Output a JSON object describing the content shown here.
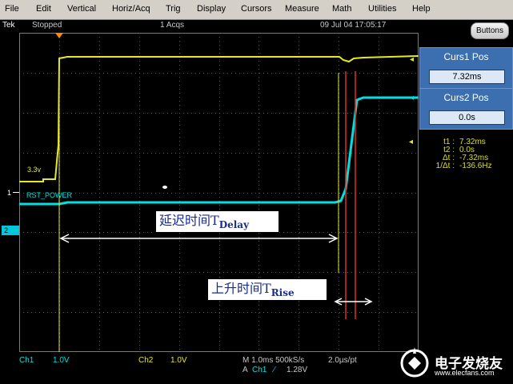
{
  "menu": [
    "File",
    "Edit",
    "Vertical",
    "Horiz/Acq",
    "Trig",
    "Display",
    "Cursors",
    "Measure",
    "Math",
    "Utilities",
    "Help"
  ],
  "status": {
    "brand": "Tek",
    "state": "Stopped",
    "acqs": "1 Acqs",
    "datetime": "09 Jul 04 17:05:17",
    "buttons_label": "Buttons"
  },
  "cursors": {
    "curs1_title": "Curs1 Pos",
    "curs1_value": "7.32ms",
    "curs2_title": "Curs2 Pos",
    "curs2_value": "0.0s"
  },
  "readouts": [
    {
      "label": "t1 :",
      "value": "7.32ms"
    },
    {
      "label": "t2 :",
      "value": "0.0s"
    },
    {
      "label": "Δt :",
      "value": "-7.32ms"
    },
    {
      "label": "1/Δt :",
      "value": "-136.6Hz"
    }
  ],
  "waveform": {
    "ch2_level_label": "3.3v",
    "ch1_label": "RST_POWER",
    "ch1_marker": "1",
    "ch2_marker": "2"
  },
  "annotations": {
    "delay_text": "延迟时间T",
    "delay_sub": "Delay",
    "rise_text": "上升时间T",
    "rise_sub": "Rise"
  },
  "bottom": {
    "ch1_name": "Ch1",
    "ch1_scale": "1.0V",
    "ch2_name": "Ch2",
    "ch2_scale": "1.0V",
    "timebase": "M 1.0ms 500kS/s",
    "per_pt": "2.0µs/pt",
    "trigger_label": "A",
    "trigger_channel": "Ch1",
    "trigger_slope": "⁄",
    "trigger_level": "1.28V"
  },
  "watermark": {
    "name": "电子发烧友",
    "url": "www.elecfans.com"
  },
  "colors": {
    "ch1": "#00e0e0",
    "ch2": "#e8e820",
    "cursor": "#e03020",
    "grid": "#5a5a5a",
    "panel": "#3b6fb0"
  }
}
